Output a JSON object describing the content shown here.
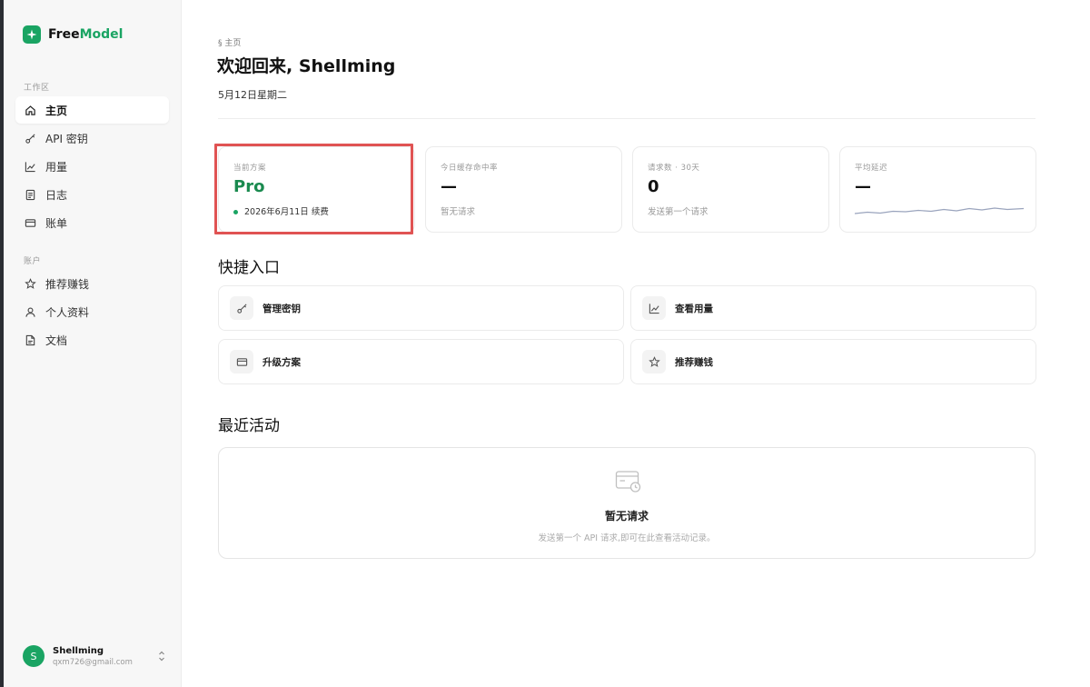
{
  "brand": {
    "name_part1": "Free",
    "name_part2": "Model",
    "accent_color": "#1aa463"
  },
  "sidebar": {
    "workspace_label": "工作区",
    "workspace_items": [
      {
        "label": "主页",
        "icon": "home-icon",
        "active": true
      },
      {
        "label": "API 密钥",
        "icon": "key-icon"
      },
      {
        "label": "用量",
        "icon": "chart-icon"
      },
      {
        "label": "日志",
        "icon": "log-icon"
      },
      {
        "label": "账单",
        "icon": "card-icon"
      }
    ],
    "account_label": "账户",
    "account_items": [
      {
        "label": "推荐赚钱",
        "icon": "star-icon"
      },
      {
        "label": "个人资料",
        "icon": "user-icon"
      },
      {
        "label": "文档",
        "icon": "doc-icon"
      }
    ],
    "user": {
      "initial": "S",
      "name": "Shellming",
      "email": "qxm726@gmail.com"
    }
  },
  "header": {
    "breadcrumb": "§ 主页",
    "title": "欢迎回来, Shellming",
    "date": "5月12日星期二"
  },
  "stats": [
    {
      "label": "当前方案",
      "value": "Pro",
      "sub": "2026年6月11日 续费"
    },
    {
      "label": "今日缓存命中率",
      "value": "—",
      "sub": "暂无请求"
    },
    {
      "label": "请求数 · 30天",
      "value": "0",
      "sub": "发送第一个请求"
    },
    {
      "label": "平均延迟",
      "value": "—"
    }
  ],
  "quick": {
    "title": "快捷入口",
    "items": [
      {
        "label": "管理密钥",
        "icon": "key-icon"
      },
      {
        "label": "查看用量",
        "icon": "chart-icon"
      },
      {
        "label": "升级方案",
        "icon": "card-icon"
      },
      {
        "label": "推荐赚钱",
        "icon": "star-icon"
      }
    ]
  },
  "activity": {
    "title": "最近活动",
    "empty_title": "暂无请求",
    "empty_sub": "发送第一个 API 请求,即可在此查看活动记录。"
  }
}
